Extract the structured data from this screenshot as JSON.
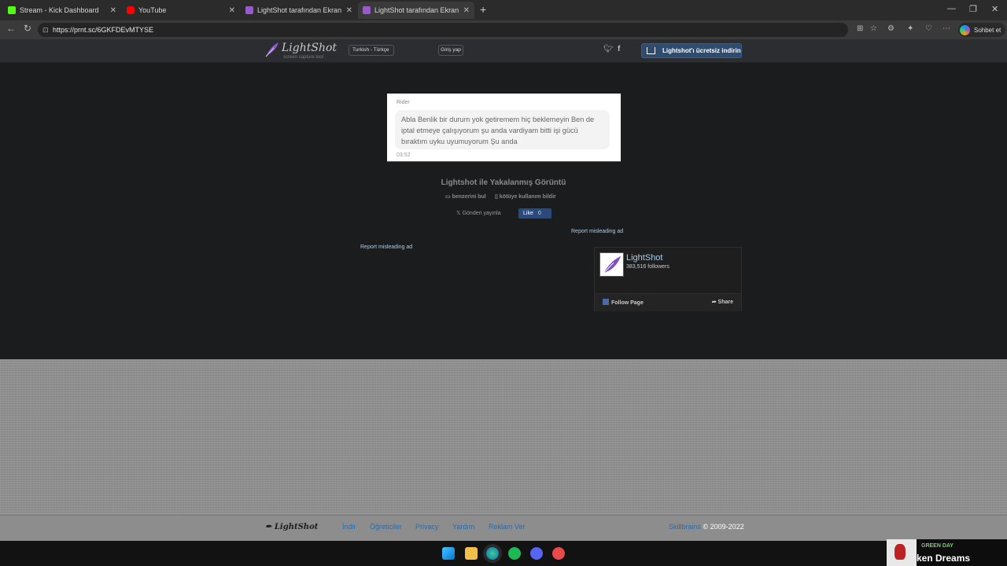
{
  "browser": {
    "tabs": [
      {
        "label": "Stream - Kick Dashboard",
        "favicon": "kick-icon",
        "color": "#53fc18"
      },
      {
        "label": "YouTube",
        "favicon": "youtube-icon",
        "color": "#ff0000"
      },
      {
        "label": "LightShot tarafından Ekran Görüntü",
        "favicon": "lightshot-icon",
        "color": "#9b59d0"
      },
      {
        "label": "LightShot tarafından Ekran Görüntü",
        "favicon": "lightshot-icon",
        "color": "#9b59d0",
        "active": true
      }
    ],
    "url": "https://prnt.sc/6GKFDEvMTYSE",
    "copilot_label": "Sohbet et"
  },
  "header": {
    "logo_text": "LightShot",
    "logo_subtitle": "screen capture tool",
    "language": "Turkish - Türkçe",
    "login": "Giriş yap",
    "download_button": "Lightshot'ı ücretsiz indirin"
  },
  "screenshot": {
    "sender": "Rider",
    "message": "Abla Benlik bir durum yok getiremem hiç beklemeyin Ben de iptal etmeye çalışıyorum şu anda vardiyam bitti işi gücü bıraktım uyku uyumuyorum Şu anda",
    "time": "03:52"
  },
  "main": {
    "caption": "Lightshot ile Yakalanmış Görüntü",
    "find_similar": "benzerini bul",
    "report_abuse": "kötüye kullanım bildir",
    "tweet": "Gönderi yayınla",
    "like": "Like",
    "like_count": "0",
    "report_ad_right": "Report misleading ad",
    "report_ad_left": "Report misleading ad"
  },
  "fb_widget": {
    "page_name": "LightShot",
    "followers": "383,516 followers",
    "follow": "Follow Page",
    "share": "Share"
  },
  "footer": {
    "logo_text": "LightShot",
    "links": [
      "İndir",
      "Öğreticiler",
      "Privacy",
      "Yardım",
      "Reklam Ver"
    ],
    "company": "Skillbrains",
    "copyright": "© 2009-2022"
  },
  "now_playing": {
    "artist": "GREEN DAY",
    "title": "ken Dreams"
  }
}
